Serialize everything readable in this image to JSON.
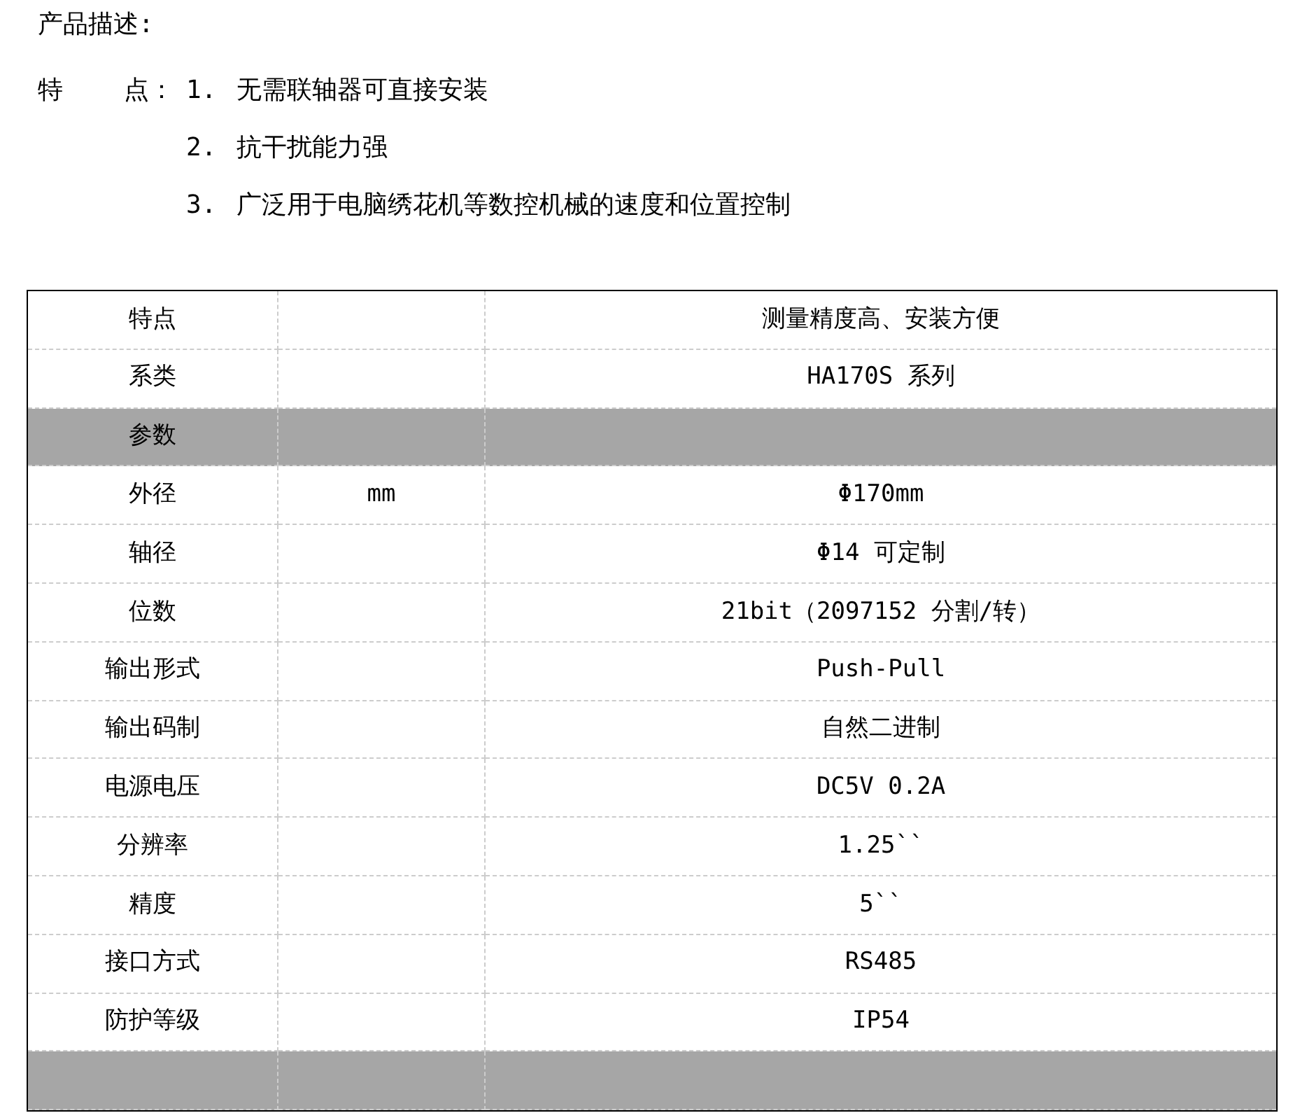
{
  "heading": "产品描述:",
  "features": {
    "label": "特    点：",
    "items": [
      {
        "number": "1.",
        "text": "无需联轴器可直接安装"
      },
      {
        "number": "2.",
        "text": "抗干扰能力强"
      },
      {
        "number": "3.",
        "text": "广泛用于电脑绣花机等数控机械的速度和位置控制"
      }
    ]
  },
  "table": {
    "rows": [
      {
        "kind": "normal",
        "cells": [
          "特点",
          "",
          "测量精度高、安装方便"
        ]
      },
      {
        "kind": "normal",
        "cells": [
          "系类",
          "",
          "HA170S 系列"
        ]
      },
      {
        "kind": "section",
        "cells": [
          "参数",
          "",
          ""
        ]
      },
      {
        "kind": "normal",
        "cells": [
          "外径",
          "mm",
          "Φ170mm"
        ]
      },
      {
        "kind": "normal",
        "cells": [
          "轴径",
          "",
          "Φ14 可定制"
        ]
      },
      {
        "kind": "normal",
        "cells": [
          "位数",
          "",
          "21bit（2097152 分割/转）"
        ]
      },
      {
        "kind": "normal",
        "cells": [
          "输出形式",
          "",
          "Push-Pull"
        ]
      },
      {
        "kind": "normal",
        "cells": [
          "输出码制",
          "",
          "自然二进制"
        ]
      },
      {
        "kind": "normal",
        "cells": [
          "电源电压",
          "",
          "DC5V 0.2A"
        ]
      },
      {
        "kind": "normal",
        "cells": [
          "分辨率",
          "",
          "1.25``"
        ]
      },
      {
        "kind": "normal",
        "cells": [
          "精度",
          "",
          "5``"
        ]
      },
      {
        "kind": "normal",
        "cells": [
          "接口方式",
          "",
          "RS485"
        ]
      },
      {
        "kind": "normal",
        "cells": [
          "防护等级",
          "",
          "IP54"
        ]
      },
      {
        "kind": "section",
        "cells": [
          "",
          "",
          ""
        ]
      }
    ]
  }
}
